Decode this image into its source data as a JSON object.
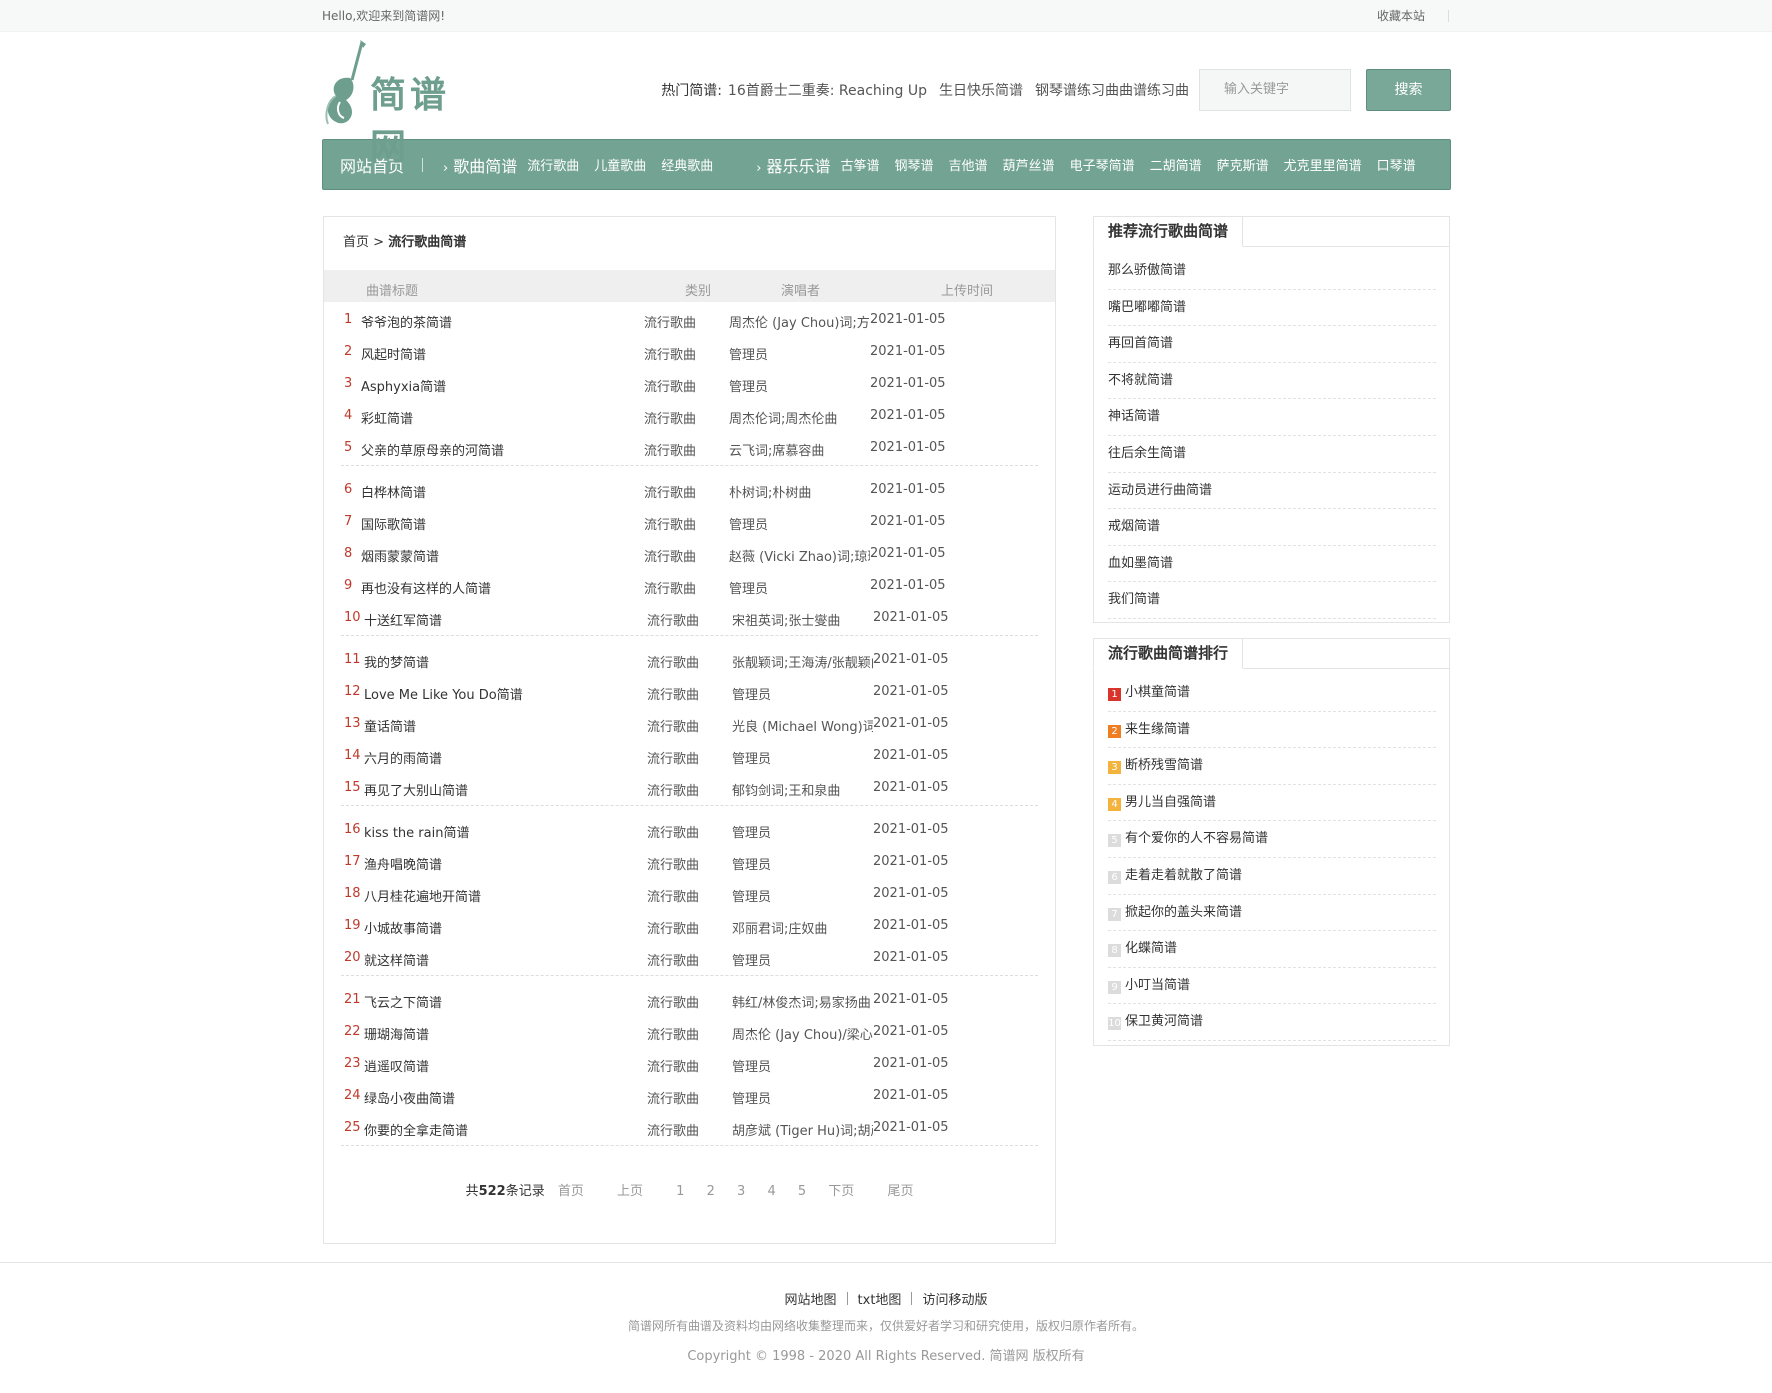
{
  "topbar": {
    "greeting": "Hello,欢迎来到简谱网!",
    "bookmark": "收藏本站"
  },
  "header": {
    "logo_text": "简谱网",
    "hot_label": "热门简谱:",
    "hot_links": [
      "16首爵士二重奏: Reaching Up",
      "生日快乐简谱",
      "钢琴谱练习曲曲谱练习曲"
    ],
    "search_placeholder": "输入关键字",
    "search_button": "搜索"
  },
  "nav": {
    "home": "网站首页",
    "song_cat": "歌曲简谱",
    "song_subs": [
      "流行歌曲",
      "儿童歌曲",
      "经典歌曲"
    ],
    "inst_cat": "器乐乐谱",
    "inst_subs": [
      "古筝谱",
      "钢琴谱",
      "吉他谱",
      "葫芦丝谱",
      "电子琴简谱",
      "二胡简谱",
      "萨克斯谱",
      "尤克里里简谱",
      "口琴谱"
    ]
  },
  "breadcrumb": {
    "home": "首页",
    "sep": ">",
    "current": "流行歌曲简谱"
  },
  "table": {
    "headers": {
      "title": "曲谱标题",
      "category": "类别",
      "singer": "演唱者",
      "date": "上传时间"
    },
    "rows": [
      {
        "n": "1",
        "title": "爷爷泡的茶简谱",
        "cat": "流行歌曲",
        "singer": "周杰伦 (Jay Chou)词;方文",
        "date": "2021-01-05"
      },
      {
        "n": "2",
        "title": "风起时简谱",
        "cat": "流行歌曲",
        "singer": "管理员",
        "date": "2021-01-05"
      },
      {
        "n": "3",
        "title": "Asphyxia简谱",
        "cat": "流行歌曲",
        "singer": "管理员",
        "date": "2021-01-05"
      },
      {
        "n": "4",
        "title": "彩虹简谱",
        "cat": "流行歌曲",
        "singer": "周杰伦词;周杰伦曲",
        "date": "2021-01-05"
      },
      {
        "n": "5",
        "title": "父亲的草原母亲的河简谱",
        "cat": "流行歌曲",
        "singer": "云飞词;席慕容曲",
        "date": "2021-01-05"
      },
      {
        "n": "6",
        "title": "白桦林简谱",
        "cat": "流行歌曲",
        "singer": "朴树词;朴树曲",
        "date": "2021-01-05"
      },
      {
        "n": "7",
        "title": "国际歌简谱",
        "cat": "流行歌曲",
        "singer": "管理员",
        "date": "2021-01-05"
      },
      {
        "n": "8",
        "title": "烟雨蒙蒙简谱",
        "cat": "流行歌曲",
        "singer": "赵薇 (Vicki Zhao)词;琼瑶",
        "date": "2021-01-05"
      },
      {
        "n": "9",
        "title": "再也没有这样的人简谱",
        "cat": "流行歌曲",
        "singer": "管理员",
        "date": "2021-01-05"
      },
      {
        "n": "10",
        "title": "十送红军简谱",
        "cat": "流行歌曲",
        "singer": "宋祖英词;张士燮曲",
        "date": "2021-01-05"
      },
      {
        "n": "11",
        "title": "我的梦简谱",
        "cat": "流行歌曲",
        "singer": "张靓颖词;王海涛/张靓颖曲",
        "date": "2021-01-05"
      },
      {
        "n": "12",
        "title": "Love Me Like You Do简谱",
        "cat": "流行歌曲",
        "singer": "管理员",
        "date": "2021-01-05"
      },
      {
        "n": "13",
        "title": "童话简谱",
        "cat": "流行歌曲",
        "singer": "光良 (Michael Wong)词;光",
        "date": "2021-01-05"
      },
      {
        "n": "14",
        "title": "六月的雨简谱",
        "cat": "流行歌曲",
        "singer": "管理员",
        "date": "2021-01-05"
      },
      {
        "n": "15",
        "title": "再见了大别山简谱",
        "cat": "流行歌曲",
        "singer": "郁钧剑词;王和泉曲",
        "date": "2021-01-05"
      },
      {
        "n": "16",
        "title": "kiss the rain简谱",
        "cat": "流行歌曲",
        "singer": "管理员",
        "date": "2021-01-05"
      },
      {
        "n": "17",
        "title": "渔舟唱晚简谱",
        "cat": "流行歌曲",
        "singer": "管理员",
        "date": "2021-01-05"
      },
      {
        "n": "18",
        "title": "八月桂花遍地开简谱",
        "cat": "流行歌曲",
        "singer": "管理员",
        "date": "2021-01-05"
      },
      {
        "n": "19",
        "title": "小城故事简谱",
        "cat": "流行歌曲",
        "singer": "邓丽君词;庄奴曲",
        "date": "2021-01-05"
      },
      {
        "n": "20",
        "title": "就这样简谱",
        "cat": "流行歌曲",
        "singer": "管理员",
        "date": "2021-01-05"
      },
      {
        "n": "21",
        "title": "飞云之下简谱",
        "cat": "流行歌曲",
        "singer": "韩红/林俊杰词;易家扬曲",
        "date": "2021-01-05"
      },
      {
        "n": "22",
        "title": "珊瑚海简谱",
        "cat": "流行歌曲",
        "singer": "周杰伦 (Jay Chou)/梁心颐",
        "date": "2021-01-05"
      },
      {
        "n": "23",
        "title": "逍遥叹简谱",
        "cat": "流行歌曲",
        "singer": "管理员",
        "date": "2021-01-05"
      },
      {
        "n": "24",
        "title": "绿岛小夜曲简谱",
        "cat": "流行歌曲",
        "singer": "管理员",
        "date": "2021-01-05"
      },
      {
        "n": "25",
        "title": "你要的全拿走简谱",
        "cat": "流行歌曲",
        "singer": "胡彦斌 (Tiger Hu)词;胡彦",
        "date": "2021-01-05"
      }
    ]
  },
  "pager": {
    "total_prefix": "共",
    "total": "522",
    "total_suffix": "条记录",
    "first": "首页",
    "prev": "上页",
    "pages": [
      "1",
      "2",
      "3",
      "4",
      "5"
    ],
    "next": "下页",
    "last": "尾页"
  },
  "sidebar": {
    "recommend_title": "推荐流行歌曲简谱",
    "recommend": [
      "那么骄傲简谱",
      "嘴巴嘟嘟简谱",
      "再回首简谱",
      "不将就简谱",
      "神话简谱",
      "往后余生简谱",
      "运动员进行曲简谱",
      "戒烟简谱",
      "血如墨简谱",
      "我们简谱"
    ],
    "ranking_title": "流行歌曲简谱排行",
    "ranking": [
      "小棋童简谱",
      "来生缘简谱",
      "断桥残雪简谱",
      "男儿当自强简谱",
      "有个爱你的人不容易简谱",
      "走着走着就散了简谱",
      "掀起你的盖头来简谱",
      "化蝶简谱",
      "小叮当简谱",
      "保卫黄河简谱"
    ],
    "rank_colors": [
      "#d9342b",
      "#ef7d22",
      "#f3b33d",
      "#f3b33d",
      "#dcdcdc",
      "#dcdcdc",
      "#dcdcdc",
      "#dcdcdc",
      "#dcdcdc",
      "#dcdcdc"
    ]
  },
  "footer": {
    "links": [
      "网站地图",
      "txt地图",
      "访问移动版"
    ],
    "note": "简谱网所有曲谱及资料均由网络收集整理而来，仅供爱好者学习和研究使用，版权归原作者所有。",
    "copyright": "Copyright © 1998 - 2020 All Rights Reserved. 简谱网 版权所有"
  },
  "colors": {
    "brand": "#73a393",
    "rank_red": "#d9342b"
  }
}
